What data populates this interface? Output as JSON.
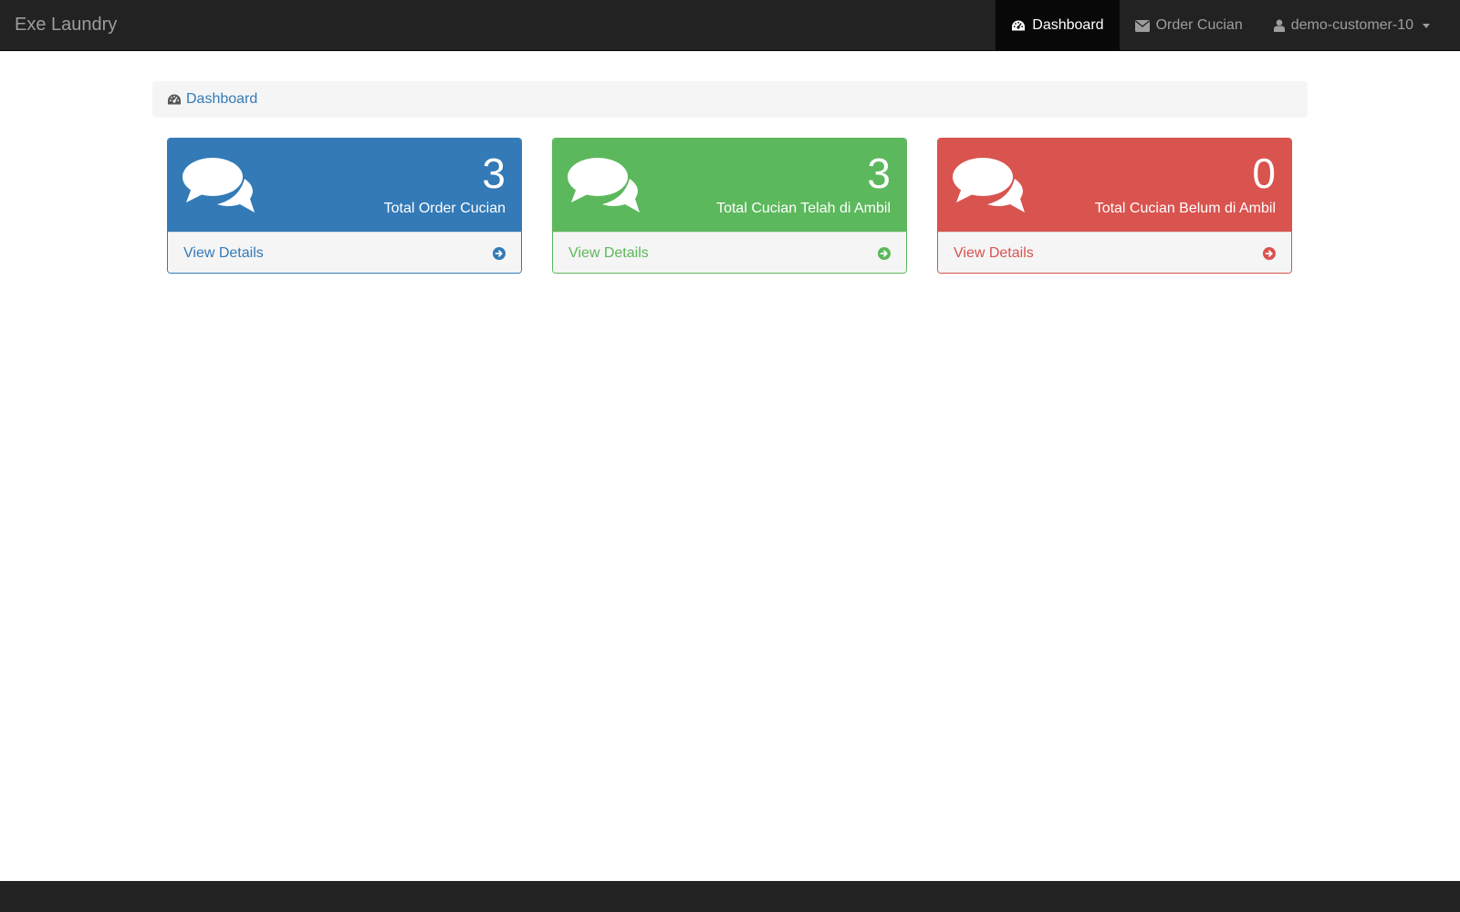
{
  "navbar": {
    "brand": "Exe Laundry",
    "items": [
      {
        "label": "Dashboard",
        "icon": "dashboard-icon",
        "active": true
      },
      {
        "label": "Order Cucian",
        "icon": "envelope-icon",
        "active": false
      },
      {
        "label": "demo-customer-10",
        "icon": "user-icon",
        "active": false,
        "dropdown": true
      }
    ]
  },
  "breadcrumb": {
    "label": "Dashboard",
    "icon": "dashboard-icon"
  },
  "panels": [
    {
      "count": "3",
      "label": "Total Order Cucian",
      "link": "View Details",
      "color": "#337ab7",
      "icon": "comments-icon"
    },
    {
      "count": "3",
      "label": "Total Cucian Telah di Ambil",
      "link": "View Details",
      "color": "#5cb85c",
      "icon": "comments-icon"
    },
    {
      "count": "0",
      "label": "Total Cucian Belum di Ambil",
      "link": "View Details",
      "color": "#d9534f",
      "icon": "comments-icon"
    }
  ],
  "colors": {
    "navbar_bg": "#222222",
    "navbar_active_bg": "#080808",
    "primary": "#337ab7",
    "success": "#5cb85c",
    "danger": "#d9534f"
  }
}
